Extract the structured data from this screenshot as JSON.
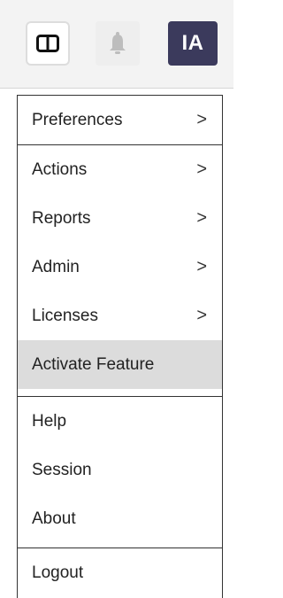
{
  "avatar": {
    "initials": "IA"
  },
  "menu": {
    "groups": [
      {
        "items": [
          {
            "label": "Preferences",
            "chevron": ">"
          }
        ]
      },
      {
        "items": [
          {
            "label": "Actions",
            "chevron": ">"
          },
          {
            "label": "Reports",
            "chevron": ">"
          },
          {
            "label": "Admin",
            "chevron": ">"
          },
          {
            "label": "Licenses",
            "chevron": ">"
          },
          {
            "label": "Activate Feature"
          }
        ]
      },
      {
        "items": [
          {
            "label": "Help"
          },
          {
            "label": "Session"
          },
          {
            "label": "About"
          }
        ]
      },
      {
        "items": [
          {
            "label": "Logout"
          }
        ]
      }
    ]
  },
  "colors": {
    "avatar_bg": "#3b3a5c",
    "active_item_bg": "#dcdcdc",
    "topbar_bg": "#f3f3f3"
  }
}
